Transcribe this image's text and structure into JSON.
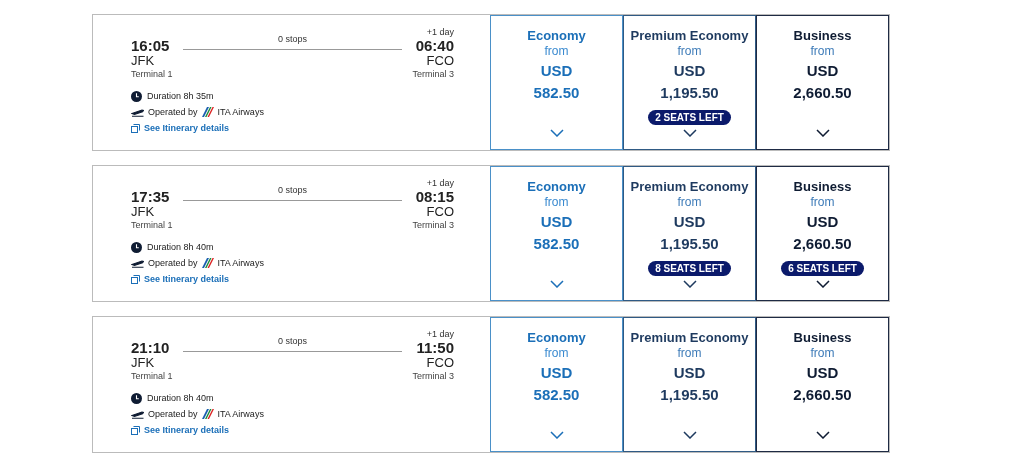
{
  "flights": [
    {
      "depart_time": "16:05",
      "depart_airport": "JFK",
      "depart_terminal": "Terminal 1",
      "stops": "0 stops",
      "day_offset": "+1 day",
      "arrive_time": "06:40",
      "arrive_airport": "FCO",
      "arrive_terminal": "Terminal 3",
      "duration": "Duration 8h 35m",
      "operated_by": "Operated by",
      "airline": "ITA Airways",
      "details_link": "See Itinerary details",
      "fares": [
        {
          "kind": "economy",
          "cabin": "Economy",
          "from": "from",
          "currency": "USD",
          "price": "582.50"
        },
        {
          "kind": "premium",
          "cabin": "Premium Economy",
          "from": "from",
          "currency": "USD",
          "price": "1,195.50",
          "seats_left": "2 SEATS LEFT"
        },
        {
          "kind": "business",
          "cabin": "Business",
          "from": "from",
          "currency": "USD",
          "price": "2,660.50"
        }
      ]
    },
    {
      "depart_time": "17:35",
      "depart_airport": "JFK",
      "depart_terminal": "Terminal 1",
      "stops": "0 stops",
      "day_offset": "+1 day",
      "arrive_time": "08:15",
      "arrive_airport": "FCO",
      "arrive_terminal": "Terminal 3",
      "duration": "Duration 8h 40m",
      "operated_by": "Operated by",
      "airline": "ITA Airways",
      "details_link": "See Itinerary details",
      "fares": [
        {
          "kind": "economy",
          "cabin": "Economy",
          "from": "from",
          "currency": "USD",
          "price": "582.50"
        },
        {
          "kind": "premium",
          "cabin": "Premium Economy",
          "from": "from",
          "currency": "USD",
          "price": "1,195.50",
          "seats_left": "8 SEATS LEFT"
        },
        {
          "kind": "business",
          "cabin": "Business",
          "from": "from",
          "currency": "USD",
          "price": "2,660.50",
          "seats_left": "6 SEATS LEFT"
        }
      ]
    },
    {
      "depart_time": "21:10",
      "depart_airport": "JFK",
      "depart_terminal": "Terminal 1",
      "stops": "0 stops",
      "day_offset": "+1 day",
      "arrive_time": "11:50",
      "arrive_airport": "FCO",
      "arrive_terminal": "Terminal 3",
      "duration": "Duration 8h 40m",
      "operated_by": "Operated by",
      "airline": "ITA Airways",
      "details_link": "See Itinerary details",
      "fares": [
        {
          "kind": "economy",
          "cabin": "Economy",
          "from": "from",
          "currency": "USD",
          "price": "582.50"
        },
        {
          "kind": "premium",
          "cabin": "Premium Economy",
          "from": "from",
          "currency": "USD",
          "price": "1,195.50"
        },
        {
          "kind": "business",
          "cabin": "Business",
          "from": "from",
          "currency": "USD",
          "price": "2,660.50"
        }
      ]
    }
  ]
}
